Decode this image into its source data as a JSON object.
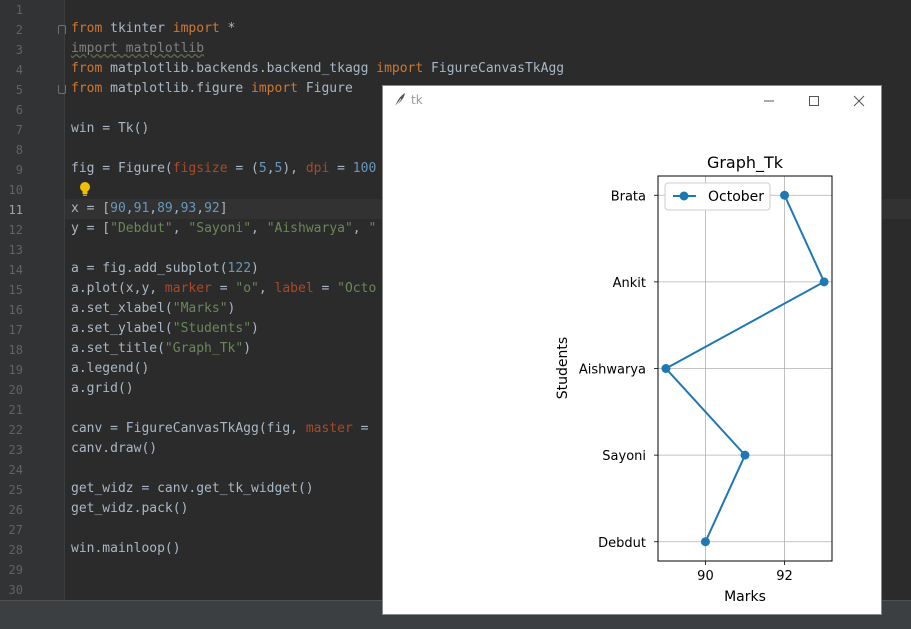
{
  "editor": {
    "line_numbers": [
      "1",
      "2",
      "3",
      "4",
      "5",
      "6",
      "7",
      "8",
      "9",
      "10",
      "11",
      "12",
      "13",
      "14",
      "15",
      "16",
      "17",
      "18",
      "19",
      "20",
      "21",
      "22",
      "23",
      "24",
      "25",
      "26",
      "27",
      "28",
      "29",
      "30"
    ],
    "current_line": "11"
  },
  "window": {
    "title": "tk"
  },
  "chart_data": {
    "type": "line",
    "title": "Graph_Tk",
    "xlabel": "Marks",
    "ylabel": "Students",
    "categories": [
      "Debdut",
      "Sayoni",
      "Aishwarya",
      "Ankit",
      "Brata"
    ],
    "series": [
      {
        "name": "October",
        "values": [
          90,
          91,
          89,
          93,
          92
        ],
        "color": "#1f77b4",
        "marker": "o"
      }
    ],
    "xticks": [
      "90",
      "92"
    ],
    "xlim": [
      88.8,
      93.2
    ],
    "grid": true,
    "legend": "upper left",
    "orientation": "horizontal-values-on-x"
  }
}
